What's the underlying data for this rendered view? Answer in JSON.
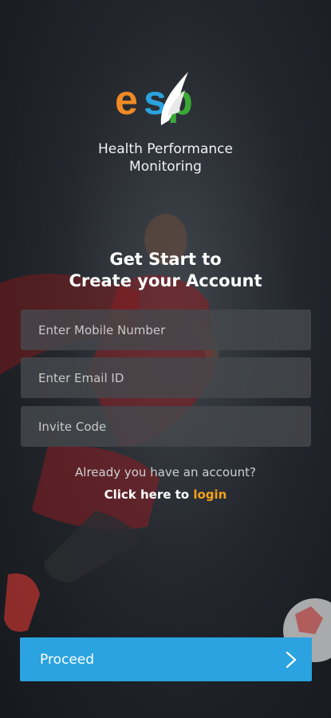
{
  "brand": {
    "logo_text": "esp",
    "colors": {
      "e": "#f08a24",
      "s": "#2aa3e0",
      "p": "#3aa935"
    },
    "subtitle": "Health Performance\nMonitoring"
  },
  "form": {
    "heading": "Get Start to\nCreate your Account",
    "mobile_placeholder": "Enter Mobile Number",
    "email_placeholder": "Enter Email ID",
    "invite_placeholder": "Invite Code"
  },
  "footer": {
    "account_question": "Already you have an account?",
    "click_here": "Click here to",
    "login_label": "login"
  },
  "proceed": {
    "label": "Proceed",
    "icon": "chevron-right-icon",
    "color": "#2aa3e0"
  }
}
